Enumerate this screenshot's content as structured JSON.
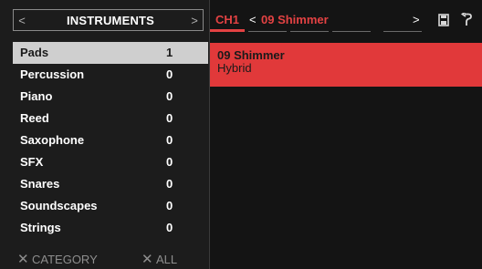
{
  "left_panel": {
    "header": {
      "title": "INSTRUMENTS",
      "prev_arrow": "<",
      "next_arrow": ">"
    },
    "categories": [
      {
        "name": "Pads",
        "count": "1",
        "selected": true
      },
      {
        "name": "Percussion",
        "count": "0",
        "selected": false
      },
      {
        "name": "Piano",
        "count": "0",
        "selected": false
      },
      {
        "name": "Reed",
        "count": "0",
        "selected": false
      },
      {
        "name": "Saxophone",
        "count": "0",
        "selected": false
      },
      {
        "name": "SFX",
        "count": "0",
        "selected": false
      },
      {
        "name": "Snares",
        "count": "0",
        "selected": false
      },
      {
        "name": "Soundscapes",
        "count": "0",
        "selected": false
      },
      {
        "name": "Strings",
        "count": "0",
        "selected": false
      }
    ],
    "footer": {
      "clear_category_label": "CATEGORY",
      "clear_all_label": "ALL",
      "clear_symbol": "✕"
    }
  },
  "right_panel": {
    "header": {
      "channel": "CH1",
      "prev_arrow": "<",
      "next_arrow": ">",
      "preset_title": "09 Shimmer",
      "save_icon": "save-icon",
      "undo_icon": "undo-icon"
    },
    "presets": [
      {
        "name": "09 Shimmer",
        "type": "Hybrid",
        "selected": true
      }
    ]
  },
  "colors": {
    "accent_red": "#e34243",
    "selected_row_red": "#e1393a",
    "selected_category_bg": "#cfcfcf",
    "panel_bg": "#1c1c1c",
    "screen_bg": "#141414"
  }
}
